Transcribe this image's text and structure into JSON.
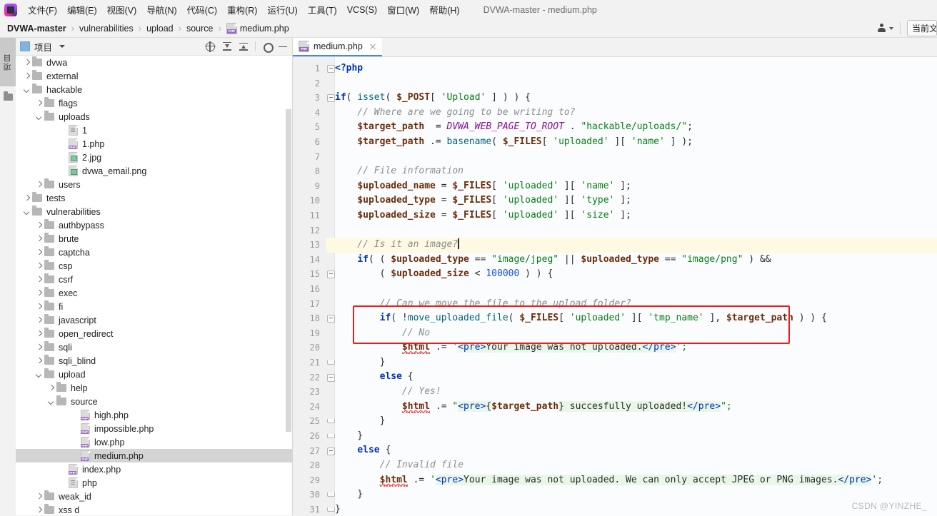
{
  "window": {
    "title": "DVWA-master - medium.php"
  },
  "menubar": {
    "items": [
      {
        "label": "文件(F)"
      },
      {
        "label": "编辑(E)"
      },
      {
        "label": "视图(V)"
      },
      {
        "label": "导航(N)"
      },
      {
        "label": "代码(C)"
      },
      {
        "label": "重构(R)"
      },
      {
        "label": "运行(U)"
      },
      {
        "label": "工具(T)"
      },
      {
        "label": "VCS(S)"
      },
      {
        "label": "窗口(W)"
      },
      {
        "label": "帮助(H)"
      }
    ]
  },
  "breadcrumb": {
    "items": [
      "DVWA-master",
      "vulnerabilities",
      "upload",
      "source",
      "medium.php"
    ],
    "separator": "›"
  },
  "navbar_right": {
    "profile_icon": "person-icon",
    "run_config_label": "当前文"
  },
  "toolstrip": {
    "project_label": "项目",
    "folder_icon": "folder-icon"
  },
  "project_panel": {
    "title": "项目",
    "tools": [
      "locate-target-icon",
      "expand-all-icon",
      "collapse-all-icon",
      "gear-icon",
      "minimize-icon"
    ],
    "tree": [
      {
        "label": "dvwa",
        "type": "folder",
        "depth": 1,
        "state": "collapsed"
      },
      {
        "label": "external",
        "type": "folder",
        "depth": 1,
        "state": "collapsed"
      },
      {
        "label": "hackable",
        "type": "folder",
        "depth": 1,
        "state": "expanded"
      },
      {
        "label": "flags",
        "type": "folder",
        "depth": 2,
        "state": "collapsed"
      },
      {
        "label": "uploads",
        "type": "folder",
        "depth": 2,
        "state": "expanded"
      },
      {
        "label": "1",
        "type": "file-txt",
        "depth": 4,
        "state": "leaf"
      },
      {
        "label": "1.php",
        "type": "file-php",
        "depth": 4,
        "state": "leaf"
      },
      {
        "label": "2.jpg",
        "type": "file-img",
        "depth": 4,
        "state": "leaf"
      },
      {
        "label": "dvwa_email.png",
        "type": "file-img",
        "depth": 4,
        "state": "leaf"
      },
      {
        "label": "users",
        "type": "folder",
        "depth": 2,
        "state": "collapsed"
      },
      {
        "label": "tests",
        "type": "folder",
        "depth": 1,
        "state": "collapsed"
      },
      {
        "label": "vulnerabilities",
        "type": "folder",
        "depth": 1,
        "state": "expanded"
      },
      {
        "label": "authbypass",
        "type": "folder",
        "depth": 2,
        "state": "collapsed"
      },
      {
        "label": "brute",
        "type": "folder",
        "depth": 2,
        "state": "collapsed"
      },
      {
        "label": "captcha",
        "type": "folder",
        "depth": 2,
        "state": "collapsed"
      },
      {
        "label": "csp",
        "type": "folder",
        "depth": 2,
        "state": "collapsed"
      },
      {
        "label": "csrf",
        "type": "folder",
        "depth": 2,
        "state": "collapsed"
      },
      {
        "label": "exec",
        "type": "folder",
        "depth": 2,
        "state": "collapsed"
      },
      {
        "label": "fi",
        "type": "folder",
        "depth": 2,
        "state": "collapsed"
      },
      {
        "label": "javascript",
        "type": "folder",
        "depth": 2,
        "state": "collapsed"
      },
      {
        "label": "open_redirect",
        "type": "folder",
        "depth": 2,
        "state": "collapsed"
      },
      {
        "label": "sqli",
        "type": "folder",
        "depth": 2,
        "state": "collapsed"
      },
      {
        "label": "sqli_blind",
        "type": "folder",
        "depth": 2,
        "state": "collapsed"
      },
      {
        "label": "upload",
        "type": "folder",
        "depth": 2,
        "state": "expanded"
      },
      {
        "label": "help",
        "type": "folder",
        "depth": 3,
        "state": "collapsed"
      },
      {
        "label": "source",
        "type": "folder",
        "depth": 3,
        "state": "expanded"
      },
      {
        "label": "high.php",
        "type": "file-php",
        "depth": 5,
        "state": "leaf"
      },
      {
        "label": "impossible.php",
        "type": "file-php",
        "depth": 5,
        "state": "leaf"
      },
      {
        "label": "low.php",
        "type": "file-php",
        "depth": 5,
        "state": "leaf"
      },
      {
        "label": "medium.php",
        "type": "file-php",
        "depth": 5,
        "state": "leaf",
        "selected": true
      },
      {
        "label": "index.php",
        "type": "file-php",
        "depth": 4,
        "state": "leaf"
      },
      {
        "label": "php",
        "type": "file-txt",
        "depth": 4,
        "state": "leaf"
      },
      {
        "label": "weak_id",
        "type": "folder",
        "depth": 2,
        "state": "collapsed"
      },
      {
        "label": "xss d",
        "type": "folder",
        "depth": 2,
        "state": "collapsed"
      }
    ]
  },
  "editor": {
    "tabs": [
      {
        "label": "medium.php",
        "icon": "php-file-icon",
        "active": true,
        "close_icon": "close-icon"
      }
    ],
    "caret_line": 13,
    "annotation": {
      "shape": "rectangle",
      "color": "#ee1b1b",
      "lines": [
        14,
        15
      ]
    },
    "lines": [
      {
        "n": 1,
        "fold": "start",
        "tokens": [
          {
            "t": "<?php",
            "c": "kw"
          }
        ]
      },
      {
        "n": 2,
        "tokens": []
      },
      {
        "n": 3,
        "fold": "start",
        "tokens": [
          {
            "t": "if",
            "c": "kw"
          },
          {
            "t": "( ",
            "c": "pun"
          },
          {
            "t": "isset",
            "c": "fn"
          },
          {
            "t": "( ",
            "c": "pun"
          },
          {
            "t": "$_POST",
            "c": "varb"
          },
          {
            "t": "[ ",
            "c": "pun"
          },
          {
            "t": "'Upload'",
            "c": "str"
          },
          {
            "t": " ] ) ) {",
            "c": "pun"
          }
        ]
      },
      {
        "n": 4,
        "tokens": [
          {
            "t": "    // Where are we going to be writing to?",
            "c": "cmt"
          }
        ]
      },
      {
        "n": 5,
        "tokens": [
          {
            "t": "    ",
            "c": "pun"
          },
          {
            "t": "$target_path",
            "c": "varb"
          },
          {
            "t": "  = ",
            "c": "pun"
          },
          {
            "t": "DVWA_WEB_PAGE_TO_ROOT",
            "c": "cst"
          },
          {
            "t": " . ",
            "c": "pun"
          },
          {
            "t": "\"hackable/uploads/\"",
            "c": "str"
          },
          {
            "t": ";",
            "c": "pun"
          }
        ]
      },
      {
        "n": 6,
        "tokens": [
          {
            "t": "    ",
            "c": "pun"
          },
          {
            "t": "$target_path",
            "c": "varb"
          },
          {
            "t": " .= ",
            "c": "pun"
          },
          {
            "t": "basename",
            "c": "fn"
          },
          {
            "t": "( ",
            "c": "pun"
          },
          {
            "t": "$_FILES",
            "c": "varb"
          },
          {
            "t": "[ ",
            "c": "pun"
          },
          {
            "t": "'uploaded'",
            "c": "str"
          },
          {
            "t": " ][ ",
            "c": "pun"
          },
          {
            "t": "'name'",
            "c": "str"
          },
          {
            "t": " ] );",
            "c": "pun"
          }
        ]
      },
      {
        "n": 7,
        "tokens": []
      },
      {
        "n": 8,
        "tokens": [
          {
            "t": "    // File information",
            "c": "cmt"
          }
        ]
      },
      {
        "n": 9,
        "tokens": [
          {
            "t": "    ",
            "c": "pun"
          },
          {
            "t": "$uploaded_name",
            "c": "varb"
          },
          {
            "t": " = ",
            "c": "pun"
          },
          {
            "t": "$_FILES",
            "c": "varb"
          },
          {
            "t": "[ ",
            "c": "pun"
          },
          {
            "t": "'uploaded'",
            "c": "str"
          },
          {
            "t": " ][ ",
            "c": "pun"
          },
          {
            "t": "'name'",
            "c": "str"
          },
          {
            "t": " ];",
            "c": "pun"
          }
        ]
      },
      {
        "n": 10,
        "tokens": [
          {
            "t": "    ",
            "c": "pun"
          },
          {
            "t": "$uploaded_type",
            "c": "varb"
          },
          {
            "t": " = ",
            "c": "pun"
          },
          {
            "t": "$_FILES",
            "c": "varb"
          },
          {
            "t": "[ ",
            "c": "pun"
          },
          {
            "t": "'uploaded'",
            "c": "str"
          },
          {
            "t": " ][ ",
            "c": "pun"
          },
          {
            "t": "'type'",
            "c": "str"
          },
          {
            "t": " ];",
            "c": "pun"
          }
        ]
      },
      {
        "n": 11,
        "tokens": [
          {
            "t": "    ",
            "c": "pun"
          },
          {
            "t": "$uploaded_size",
            "c": "varb"
          },
          {
            "t": " = ",
            "c": "pun"
          },
          {
            "t": "$_FILES",
            "c": "varb"
          },
          {
            "t": "[ ",
            "c": "pun"
          },
          {
            "t": "'uploaded'",
            "c": "str"
          },
          {
            "t": " ][ ",
            "c": "pun"
          },
          {
            "t": "'size'",
            "c": "str"
          },
          {
            "t": " ];",
            "c": "pun"
          }
        ]
      },
      {
        "n": 12,
        "tokens": []
      },
      {
        "n": 13,
        "caret": true,
        "tokens": [
          {
            "t": "    // Is it an image?",
            "c": "cmt"
          }
        ]
      },
      {
        "n": 14,
        "tokens": [
          {
            "t": "    ",
            "c": "pun"
          },
          {
            "t": "if",
            "c": "kw"
          },
          {
            "t": "( ( ",
            "c": "pun"
          },
          {
            "t": "$uploaded_type",
            "c": "varb"
          },
          {
            "t": " == ",
            "c": "pun"
          },
          {
            "t": "\"image/jpeg\"",
            "c": "str"
          },
          {
            "t": " || ",
            "c": "pun"
          },
          {
            "t": "$uploaded_type",
            "c": "varb"
          },
          {
            "t": " == ",
            "c": "pun"
          },
          {
            "t": "\"image/png\"",
            "c": "str"
          },
          {
            "t": " ) &&",
            "c": "pun"
          }
        ]
      },
      {
        "n": 15,
        "fold": "start",
        "tokens": [
          {
            "t": "        ( ",
            "c": "pun"
          },
          {
            "t": "$uploaded_size",
            "c": "varb"
          },
          {
            "t": " < ",
            "c": "pun"
          },
          {
            "t": "100000",
            "c": "num"
          },
          {
            "t": " ) ) {",
            "c": "pun"
          }
        ]
      },
      {
        "n": 16,
        "tokens": []
      },
      {
        "n": 17,
        "tokens": [
          {
            "t": "        // Can we move the file to the upload folder?",
            "c": "cmt"
          }
        ]
      },
      {
        "n": 18,
        "fold": "start",
        "tokens": [
          {
            "t": "        ",
            "c": "pun"
          },
          {
            "t": "if",
            "c": "kw"
          },
          {
            "t": "( !",
            "c": "pun"
          },
          {
            "t": "move_uploaded_file",
            "c": "fn"
          },
          {
            "t": "( ",
            "c": "pun"
          },
          {
            "t": "$_FILES",
            "c": "varb"
          },
          {
            "t": "[ ",
            "c": "pun"
          },
          {
            "t": "'uploaded'",
            "c": "str"
          },
          {
            "t": " ][ ",
            "c": "pun"
          },
          {
            "t": "'tmp_name'",
            "c": "str"
          },
          {
            "t": " ], ",
            "c": "pun"
          },
          {
            "t": "$target_path",
            "c": "varb"
          },
          {
            "t": " ) ) {",
            "c": "pun"
          }
        ]
      },
      {
        "n": 19,
        "tokens": [
          {
            "t": "            // No",
            "c": "cmt"
          }
        ]
      },
      {
        "n": 20,
        "tokens": [
          {
            "t": "            ",
            "c": "pun"
          },
          {
            "t": "$html",
            "c": "err"
          },
          {
            "t": " .= ",
            "c": "pun"
          },
          {
            "t": "'",
            "c": "str"
          },
          {
            "t": "<pre>",
            "c": "htmltag"
          },
          {
            "t": "Your image was not uploaded.",
            "c": "htmltxt"
          },
          {
            "t": "</pre>",
            "c": "htmltag"
          },
          {
            "t": "';",
            "c": "str"
          }
        ]
      },
      {
        "n": 21,
        "fold": "end",
        "tokens": [
          {
            "t": "        }",
            "c": "pun"
          }
        ]
      },
      {
        "n": 22,
        "fold": "start",
        "tokens": [
          {
            "t": "        ",
            "c": "pun"
          },
          {
            "t": "else",
            "c": "kw"
          },
          {
            "t": " {",
            "c": "pun"
          }
        ]
      },
      {
        "n": 23,
        "tokens": [
          {
            "t": "            // Yes!",
            "c": "cmt"
          }
        ]
      },
      {
        "n": 24,
        "tokens": [
          {
            "t": "            ",
            "c": "pun"
          },
          {
            "t": "$html",
            "c": "err"
          },
          {
            "t": " .= ",
            "c": "pun"
          },
          {
            "t": "\"",
            "c": "str"
          },
          {
            "t": "<pre>",
            "c": "htmltag"
          },
          {
            "t": "{",
            "c": "htmltxt"
          },
          {
            "t": "$target_path",
            "c": "varb"
          },
          {
            "t": "}",
            "c": "htmltxt"
          },
          {
            "t": " succesfully uploaded!",
            "c": "htmltxt"
          },
          {
            "t": "</pre>",
            "c": "htmltag"
          },
          {
            "t": "\";",
            "c": "str"
          }
        ]
      },
      {
        "n": 25,
        "fold": "end",
        "tokens": [
          {
            "t": "        }",
            "c": "pun"
          }
        ]
      },
      {
        "n": 26,
        "fold": "end",
        "tokens": [
          {
            "t": "    }",
            "c": "pun"
          }
        ]
      },
      {
        "n": 27,
        "fold": "start",
        "tokens": [
          {
            "t": "    ",
            "c": "pun"
          },
          {
            "t": "else",
            "c": "kw"
          },
          {
            "t": " {",
            "c": "pun"
          }
        ]
      },
      {
        "n": 28,
        "tokens": [
          {
            "t": "        // Invalid file",
            "c": "cmt"
          }
        ]
      },
      {
        "n": 29,
        "tokens": [
          {
            "t": "        ",
            "c": "pun"
          },
          {
            "t": "$html",
            "c": "err"
          },
          {
            "t": " .= ",
            "c": "pun"
          },
          {
            "t": "'",
            "c": "str"
          },
          {
            "t": "<pre>",
            "c": "htmltag"
          },
          {
            "t": "Your image was not uploaded. We can only accept JPEG or PNG images.",
            "c": "htmltxt"
          },
          {
            "t": "</pre>",
            "c": "htmltag"
          },
          {
            "t": "';",
            "c": "str"
          }
        ]
      },
      {
        "n": 30,
        "fold": "end",
        "tokens": [
          {
            "t": "    }",
            "c": "pun"
          }
        ]
      },
      {
        "n": 31,
        "fold": "end",
        "tokens": [
          {
            "t": "}",
            "c": "pun"
          }
        ]
      }
    ]
  },
  "watermark": {
    "text": "CSDN @YINZHE_"
  }
}
